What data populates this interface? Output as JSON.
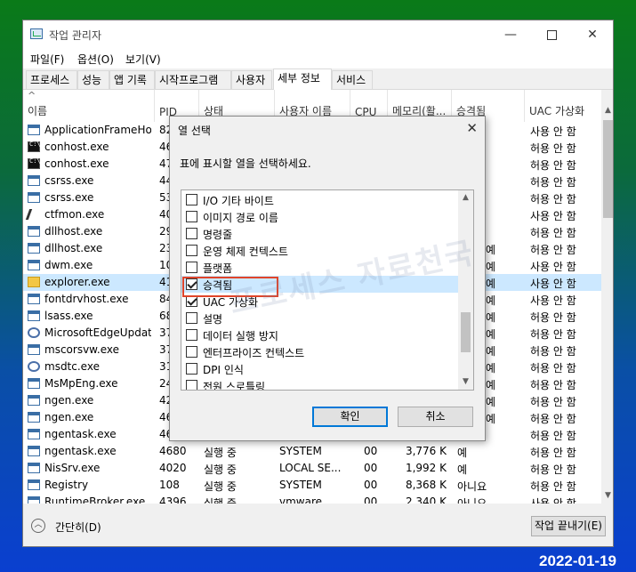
{
  "window": {
    "title": "작업 관리자",
    "controls": {
      "minimize": "—",
      "close": "✕"
    }
  },
  "menu": [
    "파일(F)",
    "옵션(O)",
    "보기(V)"
  ],
  "tabs": [
    "프로세스",
    "성능",
    "앱 기록",
    "시작프로그램",
    "사용자",
    "세부 정보",
    "서비스"
  ],
  "active_tab": "세부 정보",
  "table": {
    "columns": [
      "이름",
      "PID",
      "상태",
      "사용자 이름",
      "CPU",
      "메모리(활...",
      "승격됨",
      "UAC 가상화"
    ],
    "rows": [
      {
        "name": "ApplicationFrameHo...",
        "pid": "82",
        "uac": "사용 안 함",
        "icon": "win"
      },
      {
        "name": "conhost.exe",
        "pid": "46",
        "uac": "허용 안 함",
        "icon": "con"
      },
      {
        "name": "conhost.exe",
        "pid": "47",
        "uac": "허용 안 함",
        "icon": "con"
      },
      {
        "name": "csrss.exe",
        "pid": "44",
        "uac": "허용 안 함",
        "icon": "win"
      },
      {
        "name": "csrss.exe",
        "pid": "53",
        "uac": "허용 안 함",
        "icon": "win"
      },
      {
        "name": "ctfmon.exe",
        "pid": "40",
        "uac": "사용 안 함",
        "icon": "pen"
      },
      {
        "name": "dllhost.exe",
        "pid": "29",
        "uac": "허용 안 함",
        "icon": "win"
      },
      {
        "name": "dllhost.exe",
        "pid": "23",
        "uac": "허용 안 함",
        "icon": "win"
      },
      {
        "name": "dwm.exe",
        "pid": "10",
        "uac": "사용 안 함",
        "icon": "win"
      },
      {
        "name": "explorer.exe",
        "pid": "41",
        "uac": "사용 안 함",
        "icon": "folder",
        "selected": true
      },
      {
        "name": "fontdrvhost.exe",
        "pid": "84",
        "uac": "사용 안 함",
        "icon": "win"
      },
      {
        "name": "lsass.exe",
        "pid": "68",
        "uac": "허용 안 함",
        "icon": "win"
      },
      {
        "name": "MicrosoftEdgeUpdat...",
        "pid": "37",
        "uac": "허용 안 함",
        "icon": "gear"
      },
      {
        "name": "mscorsvw.exe",
        "pid": "37",
        "uac": "허용 안 함",
        "icon": "win"
      },
      {
        "name": "msdtc.exe",
        "pid": "31",
        "uac": "허용 안 함",
        "icon": "gear"
      },
      {
        "name": "MsMpEng.exe",
        "pid": "24",
        "uac": "허용 안 함",
        "icon": "win"
      },
      {
        "name": "ngen.exe",
        "pid": "42",
        "uac": "허용 안 함",
        "icon": "win"
      },
      {
        "name": "ngen.exe",
        "pid": "46",
        "uac": "허용 안 함",
        "icon": "win"
      },
      {
        "name": "ngentask.exe",
        "pid": "46",
        "uac": "허용 안 함",
        "icon": "win"
      },
      {
        "name": "ngentask.exe",
        "pid": "4680",
        "status": "실행 중",
        "user": "SYSTEM",
        "cpu": "00",
        "mem": "3,776 K",
        "elev": "예",
        "uac": "허용 안 함",
        "icon": "win"
      },
      {
        "name": "NisSrv.exe",
        "pid": "4020",
        "status": "실행 중",
        "user": "LOCAL SE...",
        "cpu": "00",
        "mem": "1,992 K",
        "elev": "예",
        "uac": "허용 안 함",
        "icon": "win"
      },
      {
        "name": "Registry",
        "pid": "108",
        "status": "실행 중",
        "user": "SYSTEM",
        "cpu": "00",
        "mem": "8,368 K",
        "elev": "아니요",
        "uac": "허용 안 함",
        "icon": "win"
      },
      {
        "name": "RuntimeBroker.exe",
        "pid": "4396",
        "status": "실행 중",
        "user": "vmware",
        "cpu": "00",
        "mem": "2,340 K",
        "elev": "아니요",
        "uac": "사용 안 함",
        "icon": "win"
      }
    ],
    "hidden_elev": [
      "예",
      "예",
      "예",
      "예",
      "예",
      "예",
      "예",
      "예",
      "예",
      "예",
      "예"
    ]
  },
  "footer": {
    "collapse_label": "간단히(D)",
    "end_task_label": "작업 끝내기(E)"
  },
  "dialog": {
    "title": "열 선택",
    "prompt": "표에 표시할 열을 선택하세요.",
    "items": [
      {
        "label": "I/O 기타 바이트",
        "checked": false
      },
      {
        "label": "이미지 경로 이름",
        "checked": false
      },
      {
        "label": "명령줄",
        "checked": false
      },
      {
        "label": "운영 체제 컨텍스트",
        "checked": false
      },
      {
        "label": "플랫폼",
        "checked": false
      },
      {
        "label": "승격됨",
        "checked": true,
        "highlighted": true
      },
      {
        "label": "UAC 가상화",
        "checked": true
      },
      {
        "label": "설명",
        "checked": false
      },
      {
        "label": "데이터 실행 방지",
        "checked": false
      },
      {
        "label": "엔터프라이즈 컨텍스트",
        "checked": false
      },
      {
        "label": "DPI 인식",
        "checked": false
      },
      {
        "label": "전원 스로틀링",
        "checked": false
      }
    ],
    "ok_label": "확인",
    "cancel_label": "취소"
  },
  "watermark": "프로세스 자료천국",
  "date_stamp": "2022-01-19"
}
